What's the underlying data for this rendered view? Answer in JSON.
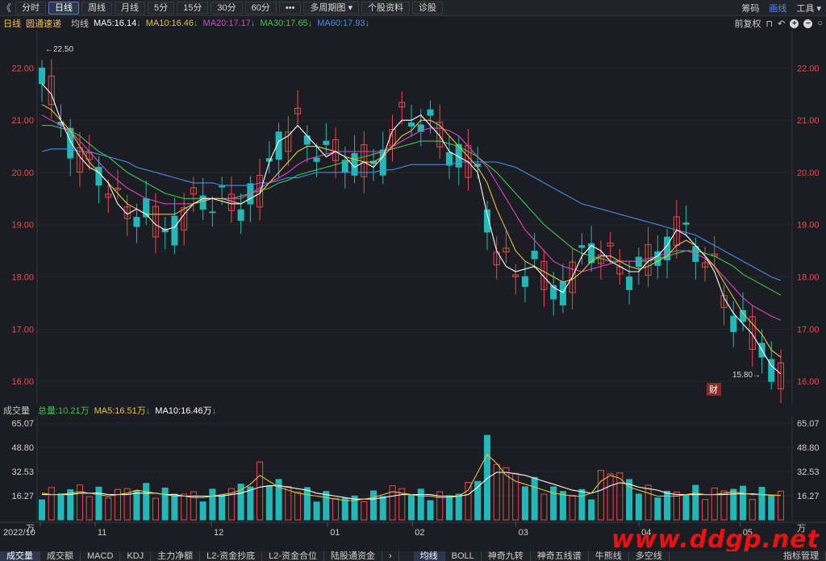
{
  "toolbar": {
    "back_glyph": "《",
    "periods": [
      "分时",
      "日线",
      "周线",
      "月线",
      "5分",
      "15分",
      "30分",
      "60分",
      "•••",
      "多周期图 ▾",
      "个股资料",
      "诊股"
    ],
    "active_index": 1,
    "right": [
      "筹码",
      "画线",
      "工具 ▾"
    ],
    "right_active": 1
  },
  "indicator": {
    "period": "日线",
    "name": "圆通速递",
    "avg_label": "均线",
    "ma5": "MA5:16.14",
    "ma10": "MA10:16.46",
    "ma20": "MA20:17.17",
    "ma30": "MA30:17.65",
    "ma60": "MA60:17.93",
    "restore_label": "前复权",
    "colors": {
      "ma5": "#ffffff",
      "ma10": "#e8c23a",
      "ma20": "#e043c8",
      "ma30": "#3ac94b",
      "ma60": "#3f8fe8",
      "name": "#f0c24a",
      "down": "#3ac94b"
    }
  },
  "price_axis": {
    "ticks": [
      "22.00",
      "21.00",
      "20.00",
      "19.00",
      "18.00",
      "17.00",
      "16.00"
    ],
    "high_label": "22.50",
    "low_label": "15.80",
    "cai_badge": "财"
  },
  "volume": {
    "title": "成交量",
    "total": "总量:10.21万",
    "ma5": "MA5:16.51万",
    "ma10": "MA10:16.46万",
    "ticks": [
      "65.07",
      "48.80",
      "32.53",
      "16.27"
    ],
    "unit": "万"
  },
  "date_axis": [
    "2022/10",
    "11",
    "12",
    "01",
    "02",
    "03",
    "04",
    "05"
  ],
  "bottom_tabs": [
    "成交量",
    "成交额",
    "MACD",
    "KDJ",
    "主力净额",
    "L2-资金抄底",
    "L2-资金合位",
    "陆股通资金",
    "›",
    "均线",
    "BOLL",
    "神奇九转",
    "神奇五线谱",
    "牛熊线",
    "多空线"
  ],
  "bottom_active": [
    0,
    9
  ],
  "bottom_right": "指标管理",
  "watermark": "www.ddgp.net",
  "chart_data": {
    "type": "candlestick",
    "price_ylim": [
      15.8,
      22.5
    ],
    "volume_ylim": [
      0,
      65.07
    ],
    "up_color": "#e84b4b",
    "down_color": "#23b8b8",
    "ma_closes": {
      "ma5": [
        21.7,
        21.5,
        21.0,
        20.6,
        20.3,
        20.1,
        20.0,
        19.8,
        19.4,
        19.2,
        19.3,
        19.2,
        19.0,
        18.9,
        18.95,
        19.2,
        19.4,
        19.5,
        19.5,
        19.45,
        19.4,
        19.4,
        19.5,
        19.6,
        20.2,
        20.6,
        20.7,
        20.9,
        20.7,
        20.5,
        20.3,
        20.4,
        20.3,
        20.1,
        20.2,
        20.1,
        20.3,
        20.8,
        21.0,
        21.0,
        21.1,
        20.9,
        20.7,
        20.4,
        20.3,
        20.2,
        20.0,
        19.2,
        18.5,
        18.2,
        18.1,
        18.15,
        18.2,
        18.0,
        17.8,
        17.7,
        18.0,
        18.4,
        18.6,
        18.5,
        18.3,
        18.2,
        18.1,
        18.1,
        18.3,
        18.4,
        18.6,
        18.9,
        18.8,
        18.6,
        18.4,
        18.1,
        17.6,
        17.3,
        17.1,
        16.9,
        16.6,
        16.3,
        16.14
      ],
      "ma10": [
        21.3,
        21.2,
        21.0,
        20.8,
        20.5,
        20.2,
        20.0,
        19.8,
        19.6,
        19.4,
        19.3,
        19.2,
        19.2,
        19.2,
        19.2,
        19.3,
        19.4,
        19.45,
        19.5,
        19.5,
        19.45,
        19.4,
        19.5,
        19.6,
        19.8,
        20.0,
        20.2,
        20.4,
        20.5,
        20.5,
        20.45,
        20.4,
        20.3,
        20.25,
        20.2,
        20.2,
        20.3,
        20.5,
        20.7,
        20.8,
        21.0,
        21.0,
        20.9,
        20.7,
        20.5,
        20.3,
        20.1,
        19.8,
        19.3,
        18.9,
        18.5,
        18.3,
        18.2,
        18.1,
        18.0,
        17.9,
        17.95,
        18.1,
        18.3,
        18.4,
        18.4,
        18.3,
        18.2,
        18.15,
        18.2,
        18.3,
        18.4,
        18.6,
        18.7,
        18.6,
        18.4,
        18.2,
        17.9,
        17.6,
        17.3,
        17.1,
        16.9,
        16.6,
        16.46
      ],
      "ma20": [
        21.1,
        21.0,
        20.9,
        20.8,
        20.6,
        20.4,
        20.2,
        20.0,
        19.85,
        19.7,
        19.6,
        19.5,
        19.45,
        19.4,
        19.4,
        19.4,
        19.4,
        19.45,
        19.5,
        19.5,
        19.5,
        19.5,
        19.6,
        19.7,
        19.8,
        19.9,
        20.0,
        20.15,
        20.25,
        20.3,
        20.35,
        20.4,
        20.4,
        20.4,
        20.4,
        20.4,
        20.4,
        20.5,
        20.6,
        20.7,
        20.8,
        20.85,
        20.85,
        20.8,
        20.7,
        20.5,
        20.3,
        20.1,
        19.8,
        19.5,
        19.2,
        18.9,
        18.7,
        18.5,
        18.3,
        18.2,
        18.15,
        18.1,
        18.15,
        18.2,
        18.25,
        18.3,
        18.3,
        18.3,
        18.35,
        18.4,
        18.45,
        18.5,
        18.5,
        18.45,
        18.35,
        18.2,
        18.0,
        17.8,
        17.6,
        17.45,
        17.35,
        17.25,
        17.17
      ],
      "ma30": [
        20.9,
        20.9,
        20.85,
        20.8,
        20.7,
        20.55,
        20.4,
        20.3,
        20.15,
        20.0,
        19.9,
        19.8,
        19.7,
        19.6,
        19.55,
        19.5,
        19.5,
        19.5,
        19.5,
        19.5,
        19.5,
        19.55,
        19.6,
        19.65,
        19.7,
        19.8,
        19.85,
        19.95,
        20.0,
        20.05,
        20.1,
        20.15,
        20.2,
        20.25,
        20.3,
        20.35,
        20.4,
        20.45,
        20.5,
        20.55,
        20.6,
        20.6,
        20.6,
        20.55,
        20.5,
        20.4,
        20.3,
        20.15,
        20.0,
        19.8,
        19.6,
        19.4,
        19.2,
        19.0,
        18.85,
        18.7,
        18.55,
        18.45,
        18.4,
        18.35,
        18.3,
        18.3,
        18.3,
        18.3,
        18.3,
        18.35,
        18.4,
        18.45,
        18.5,
        18.5,
        18.45,
        18.4,
        18.3,
        18.2,
        18.05,
        17.95,
        17.85,
        17.75,
        17.65
      ],
      "ma60": [
        20.4,
        20.45,
        20.45,
        20.45,
        20.4,
        20.4,
        20.35,
        20.3,
        20.25,
        20.2,
        20.1,
        20.05,
        20.0,
        19.95,
        19.9,
        19.85,
        19.8,
        19.8,
        19.8,
        19.75,
        19.75,
        19.75,
        19.75,
        19.8,
        19.8,
        19.85,
        19.9,
        19.9,
        19.95,
        20.0,
        20.0,
        20.0,
        20.0,
        20.0,
        20.0,
        20.0,
        20.05,
        20.05,
        20.1,
        20.15,
        20.15,
        20.15,
        20.15,
        20.15,
        20.2,
        20.2,
        20.2,
        20.2,
        20.2,
        20.15,
        20.1,
        20.0,
        19.9,
        19.8,
        19.7,
        19.6,
        19.5,
        19.4,
        19.35,
        19.3,
        19.25,
        19.2,
        19.15,
        19.1,
        19.05,
        19.0,
        18.95,
        18.9,
        18.85,
        18.8,
        18.7,
        18.6,
        18.5,
        18.4,
        18.3,
        18.2,
        18.1,
        18.0,
        17.93
      ]
    },
    "volume_ma5": [
      18,
      17,
      17,
      18,
      19,
      18,
      17,
      16,
      17,
      18,
      20,
      19,
      18,
      17,
      16,
      16,
      15,
      15,
      16,
      17,
      18,
      20,
      24,
      30,
      26,
      22,
      20,
      18,
      17,
      16,
      15,
      14,
      13,
      13,
      14,
      15,
      17,
      19,
      18,
      17,
      16,
      16,
      15,
      15,
      16,
      20,
      32,
      44,
      38,
      30,
      26,
      24,
      22,
      20,
      18,
      17,
      16,
      16,
      18,
      26,
      30,
      28,
      22,
      20,
      18,
      16,
      16,
      16,
      17,
      18,
      17,
      17,
      18,
      19,
      18,
      17,
      17,
      16.5,
      16.51
    ],
    "volume_ma10": [
      17,
      17,
      17,
      17,
      18,
      18,
      18,
      17,
      17,
      17,
      18,
      18,
      18,
      17,
      17,
      16,
      16,
      16,
      16,
      16,
      17,
      18,
      20,
      22,
      23,
      23,
      22,
      21,
      20,
      18,
      17,
      16,
      15,
      14,
      14,
      14,
      15,
      16,
      17,
      17,
      17,
      17,
      16,
      16,
      16,
      17,
      22,
      28,
      32,
      32,
      31,
      30,
      28,
      26,
      24,
      22,
      20,
      19,
      18,
      20,
      23,
      25,
      24,
      22,
      21,
      20,
      18,
      17,
      17,
      17,
      17,
      17,
      17,
      17.5,
      17.5,
      17.5,
      17,
      16.7,
      16.46
    ]
  }
}
